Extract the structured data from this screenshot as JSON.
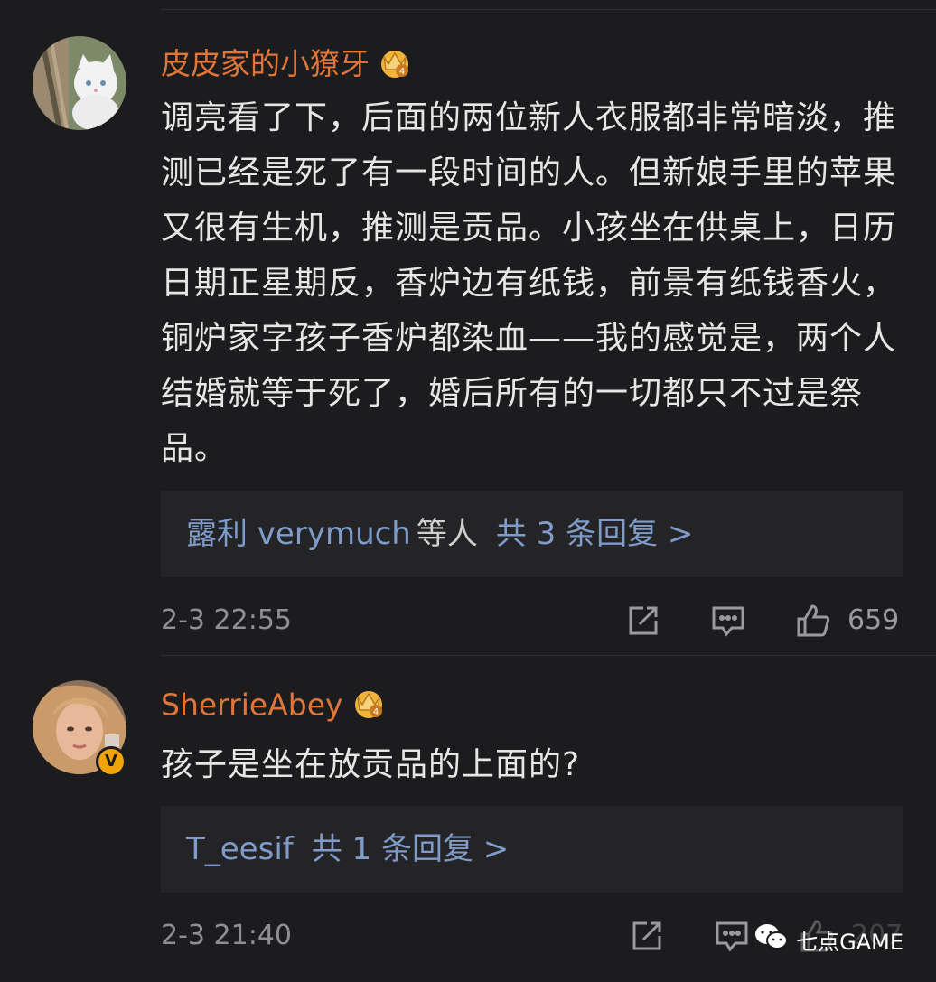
{
  "comments": [
    {
      "username": "皮皮家的小獠牙",
      "badge_level": "4",
      "text": "调亮看了下，后面的两位新人衣服都非常暗淡，推测已经是死了有一段时间的人。但新娘手里的苹果又很有生机，推测是贡品。小孩坐在供桌上，日历日期正星期反，香炉边有纸钱，前景有纸钱香火，铜炉家字孩子香炉都染血——我的感觉是，两个人结婚就等于死了，婚后所有的一切都只不过是祭品。",
      "reply_names": "露利 verymuch",
      "reply_etc": "等人",
      "reply_count": "共 3 条回复 >",
      "timestamp": "2-3 22:55",
      "likes": "659"
    },
    {
      "username": "SherrieAbey",
      "badge_level": "4",
      "verified_mark": "V",
      "text": "孩子是坐在放贡品的上面的?",
      "reply_names": "T_eesif",
      "reply_count": "共 1 条回复 >",
      "timestamp": "2-3 21:40",
      "likes": "207"
    }
  ],
  "watermark": "七点GAME",
  "colors": {
    "background": "#1c1c1e",
    "username": "#e0753a",
    "reply_link": "#7f9bc9",
    "reply_box": "#242426",
    "meta": "#8e8e93",
    "crown": "#f0b43c"
  },
  "icons": [
    "share-icon",
    "comment-icon",
    "thumbs-up-icon",
    "crown-badge-icon",
    "verified-icon",
    "wechat-icon"
  ]
}
